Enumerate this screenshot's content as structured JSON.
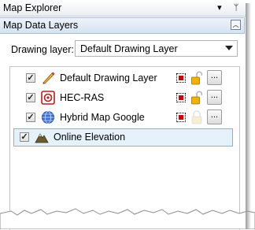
{
  "window": {
    "title": "Map Explorer",
    "pin_glyph": "ᛘ"
  },
  "section": {
    "title": "Map Data Layers",
    "collapse_glyph": "︿"
  },
  "drawing_layer": {
    "label": "Drawing layer:",
    "value": "Default Drawing Layer"
  },
  "layers": [
    {
      "name": "Default Drawing Layer",
      "checked": true,
      "icon": "pencil-icon",
      "has_symbol": true,
      "lock": "unlocked",
      "has_more_button": true
    },
    {
      "name": "HEC-RAS",
      "checked": true,
      "icon": "hec-ras-icon",
      "has_symbol": true,
      "lock": "unlocked",
      "has_more_button": true
    },
    {
      "name": "Hybrid Map Google",
      "checked": true,
      "icon": "globe-icon",
      "has_symbol": true,
      "lock": "disabled",
      "has_more_button": true
    },
    {
      "name": "Online Elevation",
      "checked": true,
      "icon": "mountain-icon",
      "selected": true,
      "has_symbol": false,
      "has_more_button": false
    }
  ],
  "more_button_label": "...",
  "checkbox_glyph": "✓",
  "colors": {
    "selection_fill": "#e5f2fb",
    "selection_border": "#7fb4dc",
    "symbol_red": "#d40000",
    "lock_gold": "#e0a100"
  }
}
